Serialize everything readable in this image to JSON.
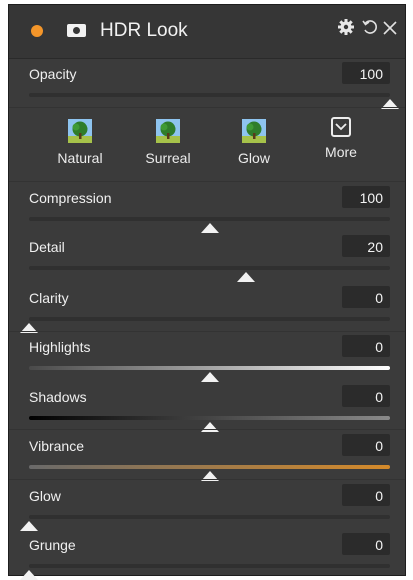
{
  "panel": {
    "title": "HDR Look"
  },
  "icons": {
    "settings": "gear-icon",
    "reset": "reset-icon",
    "close": "close-icon",
    "camera": "camera-icon"
  },
  "presets": [
    {
      "label": "Natural",
      "icon": "tree-icon"
    },
    {
      "label": "Surreal",
      "icon": "tree-icon"
    },
    {
      "label": "Glow",
      "icon": "tree-icon"
    },
    {
      "label": "More",
      "icon": "chevron-down-icon"
    }
  ],
  "sliders": [
    {
      "key": "opacity",
      "label": "Opacity",
      "value": "100",
      "level": 1.0
    },
    {
      "key": "compression",
      "label": "Compression",
      "value": "100",
      "level": 0.5
    },
    {
      "key": "detail",
      "label": "Detail",
      "value": "20",
      "level": 0.6
    },
    {
      "key": "clarity",
      "label": "Clarity",
      "value": "0",
      "level": 0.0
    },
    {
      "key": "highlights",
      "label": "Highlights",
      "value": "0",
      "level": 0.5
    },
    {
      "key": "shadows",
      "label": "Shadows",
      "value": "0",
      "level": 0.5
    },
    {
      "key": "vibrance",
      "label": "Vibrance",
      "value": "0",
      "level": 0.5
    },
    {
      "key": "glow",
      "label": "Glow",
      "value": "0",
      "level": 0.0
    },
    {
      "key": "grunge",
      "label": "Grunge",
      "value": "0",
      "level": 0.0
    }
  ],
  "colors": {
    "accent": "#f4962a",
    "vibrance_track": "#c37a22"
  }
}
